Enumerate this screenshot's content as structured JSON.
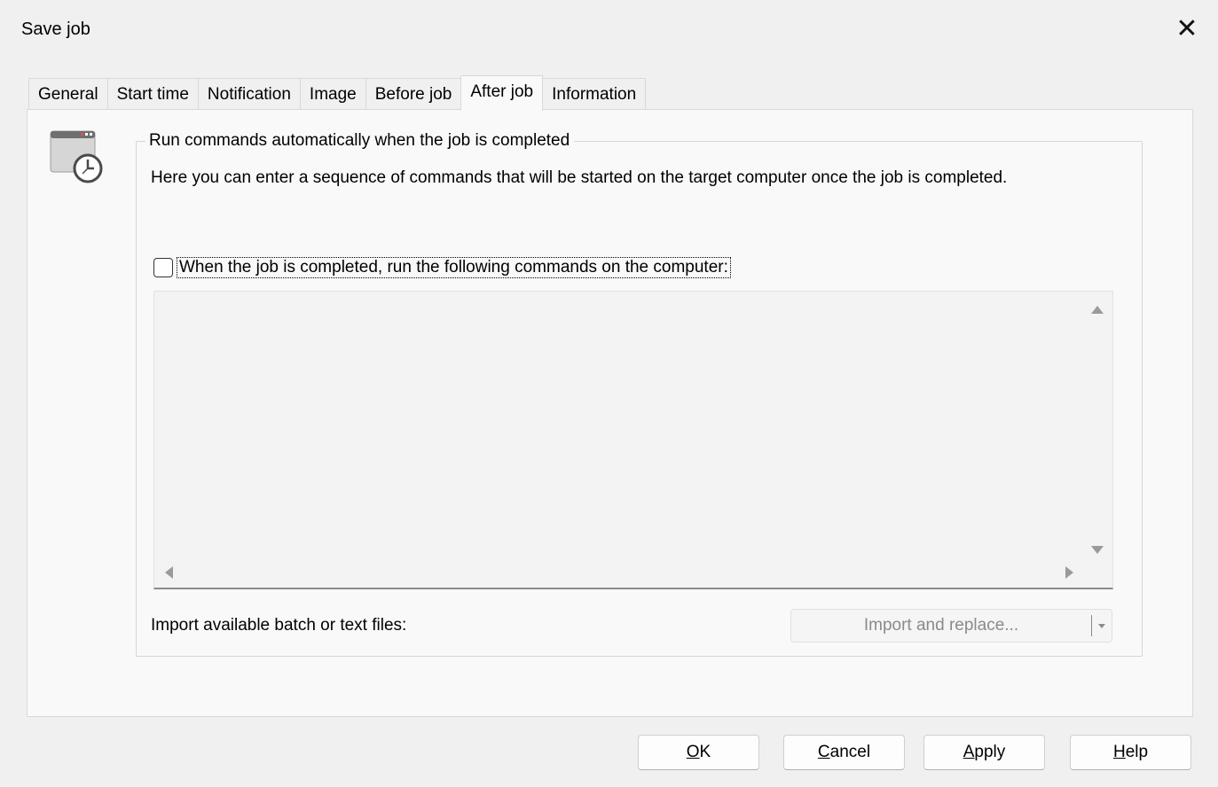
{
  "window": {
    "title": "Save job",
    "close_glyph": "✕"
  },
  "tabs": [
    {
      "label": "General",
      "active": false
    },
    {
      "label": "Start time",
      "active": false
    },
    {
      "label": "Notification",
      "active": false
    },
    {
      "label": "Image",
      "active": false
    },
    {
      "label": "Before job",
      "active": false
    },
    {
      "label": "After job",
      "active": true
    },
    {
      "label": "Information",
      "active": false
    }
  ],
  "after_job": {
    "icon": "job-clock-icon",
    "group_title": "Run commands automatically when the job is completed",
    "description": "Here you can enter a sequence of commands that will be started on the target computer once the job is completed.",
    "run_commands_label": "When the job is completed, run the following commands on the computer:",
    "run_commands_checked": false,
    "commands_value": "",
    "import_label": "Import available batch or text files:",
    "import_button_label": "Import and replace..."
  },
  "buttons": {
    "ok": {
      "pre": "",
      "mnemonic": "O",
      "post": "K"
    },
    "cancel": {
      "pre": "",
      "mnemonic": "C",
      "post": "ancel"
    },
    "apply": {
      "pre": "",
      "mnemonic": "A",
      "post": "pply"
    },
    "help": {
      "pre": "",
      "mnemonic": "H",
      "post": "elp"
    }
  },
  "colors": {
    "dialog_bg": "#f0f0f0",
    "panel_bg": "#f9f9f9",
    "disabled_text": "#8a8a8a"
  }
}
